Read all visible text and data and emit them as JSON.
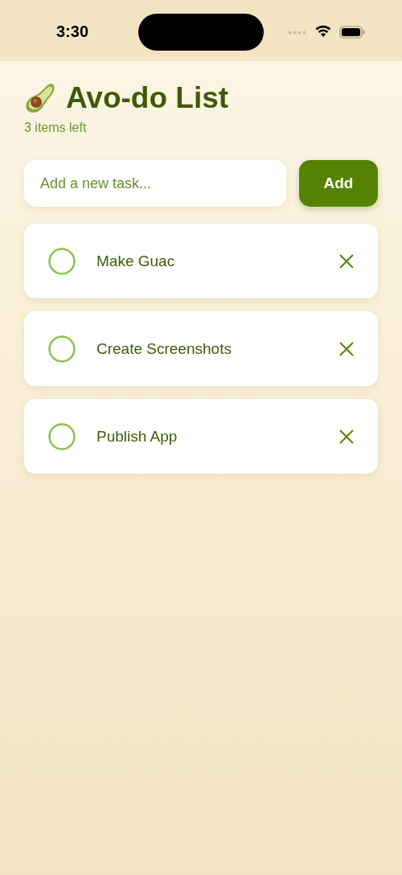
{
  "status_bar": {
    "time": "3:30"
  },
  "header": {
    "title": "Avo-do List",
    "subtitle": "3 items left"
  },
  "new_task": {
    "placeholder": "Add a new task...",
    "button": "Add"
  },
  "tasks": [
    {
      "label": "Make Guac",
      "checked": false
    },
    {
      "label": "Create Screenshots",
      "checked": false
    },
    {
      "label": "Publish App",
      "checked": false
    }
  ]
}
